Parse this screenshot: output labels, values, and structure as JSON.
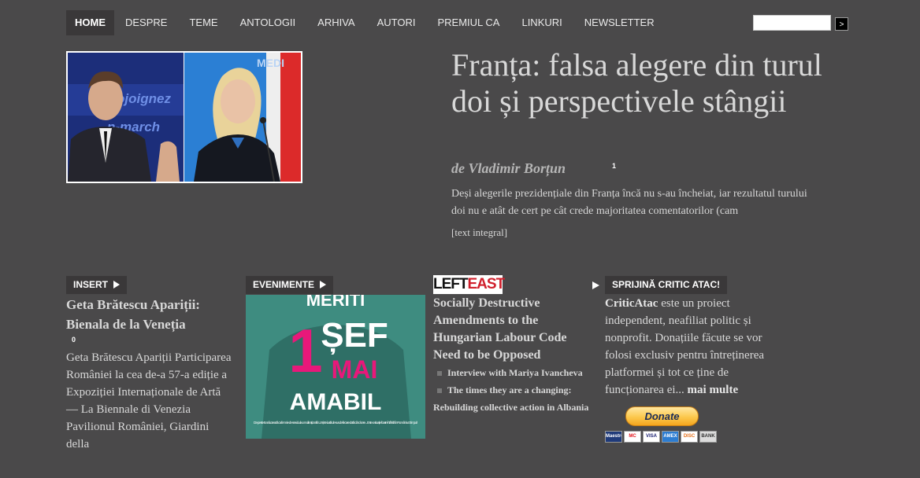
{
  "nav": {
    "items": [
      "HOME",
      "DESPRE",
      "TEME",
      "ANTOLOGII",
      "ARHIVA",
      "AUTORI",
      "PREMIUL CA",
      "LINKURI",
      "NEWSLETTER"
    ],
    "search_button": ">"
  },
  "featured": {
    "image_alt": "Macron & Le Pen",
    "image_text_left": "ojoignez",
    "image_text_left2": "n-march",
    "image_text_right": "MEDI",
    "title": "Franța: falsa alegere din turul doi și perspectivele stângii",
    "byline": "de Vladimir Borțun",
    "comments": "1",
    "excerpt": "Deși alegerile prezidențiale din Franța încă nu s-au încheiat, iar rezultatul turului doi nu e atât de cert pe cât crede majoritatea comentatorilor (cam",
    "read_more": "[text integral]"
  },
  "insert": {
    "tag": "INSERT",
    "title": "Geta Brătescu Apariții: Bienala de la Veneția",
    "comments": "0",
    "text": "Geta Brătescu Apariții Participarea României la cea de-a 57-a ediție a Expoziției Internaționale de Artă — La Biennale di Venezia Pavilionul României, Giardini della"
  },
  "evenimente": {
    "tag": "EVENIMENTE",
    "poster_top": "MERITI",
    "poster_num": "1",
    "poster_sef": "ȘEF",
    "poster_mai": "MAI",
    "poster_amabil": "AMABIL",
    "poster_caption": "De peste 8 ani lucrează ca femeie de serviciu la o multinațională. Un ținte luată de sus de fiecare dată când cere ... Este o situație foarte întâlnită în România. E timpul!"
  },
  "lefteast": {
    "logo_left": "LEFT",
    "logo_right": "EAST",
    "title": "Socially Destructive Amendments to the Hungarian Labour Code Need to be Opposed",
    "links": [
      "Interview with Mariya Ivancheva",
      "The times they are a changing: Rebuilding collective action in Albania"
    ]
  },
  "support": {
    "tag": "SPRIJINĂ CRITIC ATAC!",
    "brand": "CriticAtac",
    "text": " este un proiect independent, neafiliat politic și nonprofit. Donațiile făcute se vor folosi exclusiv pentru întreținerea platformei și tot ce ține de funcționarea ei... ",
    "more": "mai multe",
    "donate": "Donate",
    "cards": [
      "Maestro",
      "MC",
      "VISA",
      "AMEX",
      "DISC",
      "BANK"
    ]
  },
  "colors": {
    "background": "#4a494a",
    "tag_bg": "#3a3839",
    "accent_red": "#e8187a"
  }
}
